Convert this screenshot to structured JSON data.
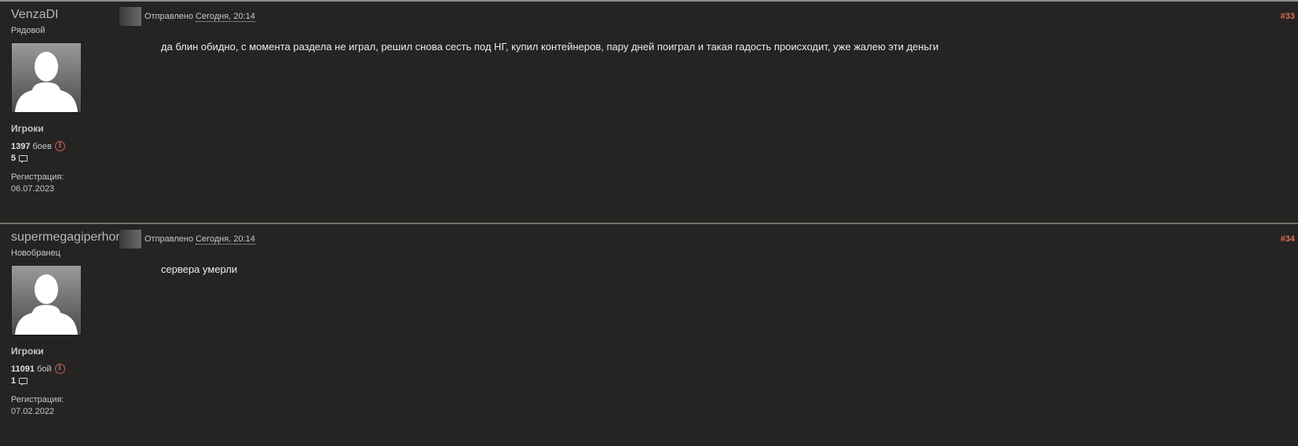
{
  "posts": [
    {
      "username": "VenzaDI",
      "rank": "Рядовой",
      "group": "Игроки",
      "battles_count": "1397",
      "battles_word": "боев",
      "posts_count": "5",
      "reg_label": "Регистрация:",
      "reg_date": "06.07.2023",
      "sent_label": "Отправлено",
      "sent_date": "Сегодня, 20:14",
      "post_number": "#33",
      "body": "да блин обидно, с момента раздела не играл, решил снова сесть под НГ, купил контейнеров, пару дней поиграл и такая гадость происходит, уже жалею эти деньги"
    },
    {
      "username": "supermegagiperhoros",
      "rank": "Новобранец",
      "group": "Игроки",
      "battles_count": "11091",
      "battles_word": "бой",
      "posts_count": "1",
      "reg_label": "Регистрация:",
      "reg_date": "07.02.2022",
      "sent_label": "Отправлено",
      "sent_date": "Сегодня, 20:14",
      "post_number": "#34",
      "body": "сервера умерли"
    }
  ],
  "icons": {
    "info": "info-icon",
    "comment": "comment-icon",
    "avatar": "default-avatar-silhouette"
  },
  "colors": {
    "background": "#252422",
    "post_number": "#e06a5a",
    "info_icon": "#d06060"
  }
}
